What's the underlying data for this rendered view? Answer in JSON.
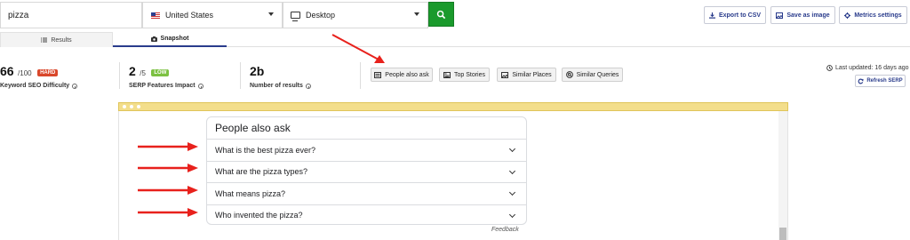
{
  "search": {
    "query": "pizza",
    "country": "United States",
    "device": "Desktop"
  },
  "toolbar": {
    "export_label": "Export to CSV",
    "save_image_label": "Save as image",
    "metrics_label": "Metrics settings"
  },
  "tabs": [
    {
      "label": "Results",
      "icon": "list-icon"
    },
    {
      "label": "Snapshot",
      "icon": "camera-icon"
    }
  ],
  "metrics": {
    "difficulty": {
      "value": "66",
      "max": "/100",
      "badge": "HARD",
      "badge_color": "#d9472b",
      "label": "Keyword SEO Difficulty"
    },
    "serp_impact": {
      "value": "2",
      "max": "/5",
      "badge": "LOW",
      "badge_color": "#7cc142",
      "label": "SERP Features Impact"
    },
    "results": {
      "value": "2b",
      "label": "Number of results"
    }
  },
  "features": [
    {
      "label": "People also ask",
      "icon": "paa-icon"
    },
    {
      "label": "Top Stories",
      "icon": "news-icon"
    },
    {
      "label": "Similar Places",
      "icon": "image-icon"
    },
    {
      "label": "Similar Queries",
      "icon": "search-circle-icon"
    }
  ],
  "status": {
    "last_updated": "Last updated: 16 days ago",
    "refresh_label": "Refresh SERP"
  },
  "paa": {
    "title": "People also ask",
    "questions": [
      "What is the best pizza ever?",
      "What are the pizza types?",
      "What means pizza?",
      "Who invented the pizza?"
    ],
    "feedback": "Feedback"
  },
  "colors": {
    "accent": "#2a3c8c",
    "search_button": "#1a9a2c",
    "annotation_arrow": "#e8211c",
    "browser_bar": "#f3de8b"
  }
}
